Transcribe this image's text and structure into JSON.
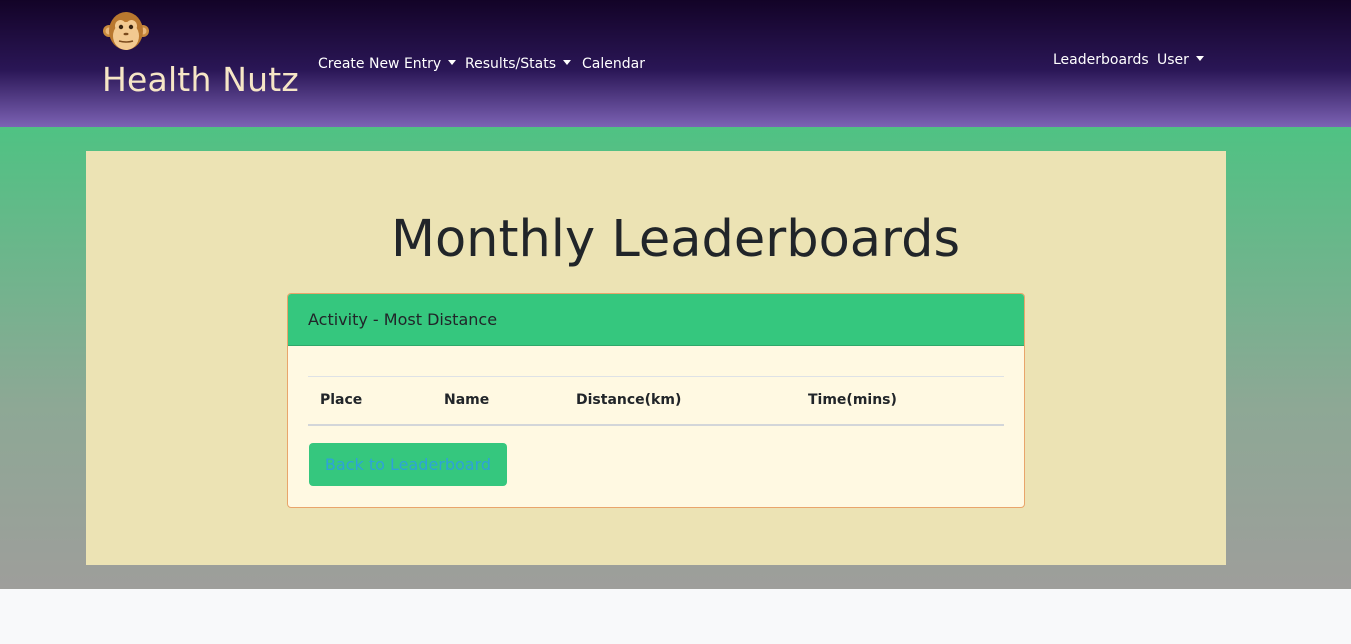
{
  "navbar": {
    "brand": "Health Nutz",
    "links": {
      "create_new_entry": "Create New Entry",
      "results_stats": "Results/Stats",
      "calendar": "Calendar",
      "leaderboards": "Leaderboards",
      "user": "User"
    }
  },
  "page": {
    "title": "Monthly Leaderboards"
  },
  "card": {
    "title": "Activity - Most Distance",
    "table": {
      "headers": [
        "Place",
        "Name",
        "Distance(km)",
        "Time(mins)"
      ],
      "rows": []
    },
    "back_button": "Back to Leaderboard"
  },
  "colors": {
    "navbar_top": "#130327",
    "navbar_bottom": "#7c62b4",
    "brand_text": "#f6e6c6",
    "accent_green": "#35c77e",
    "container_bg": "#ece3b4",
    "card_bg": "#fff9e2",
    "card_border": "#e9a56b",
    "button_text": "#2ea2d8"
  },
  "icons": {
    "logo": "monkey-face-icon"
  }
}
